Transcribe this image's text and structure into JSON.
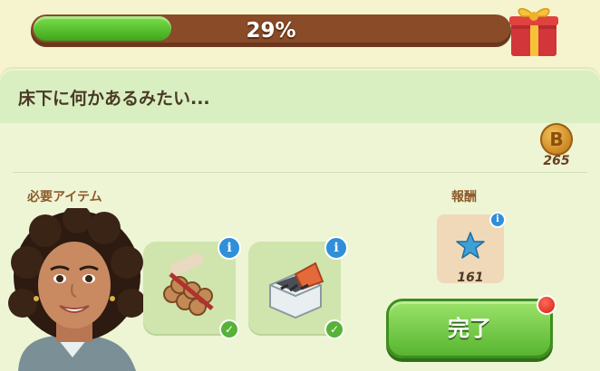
{
  "progress": {
    "percent_text": "29%",
    "fraction": 0.29
  },
  "quest": {
    "title": "床下に何かあるみたい..."
  },
  "currency": {
    "icon": "coin-icon",
    "count": "265"
  },
  "labels": {
    "required_items": "必要アイテム",
    "reward": "報酬"
  },
  "items": [
    {
      "icon": "wood-logs-icon",
      "info_icon": "info-icon",
      "status_icon": "check-icon",
      "complete": true
    },
    {
      "icon": "tool-box-icon",
      "info_icon": "info-icon",
      "status_icon": "check-icon",
      "complete": true
    }
  ],
  "reward": {
    "icon": "blue-star-icon",
    "count": "161",
    "info_icon": "info-icon"
  },
  "complete_button": {
    "label": "完了"
  },
  "colors": {
    "accent_green": "#58b531",
    "progress_track": "#8a4b28",
    "info_blue": "#2f8fd8"
  }
}
